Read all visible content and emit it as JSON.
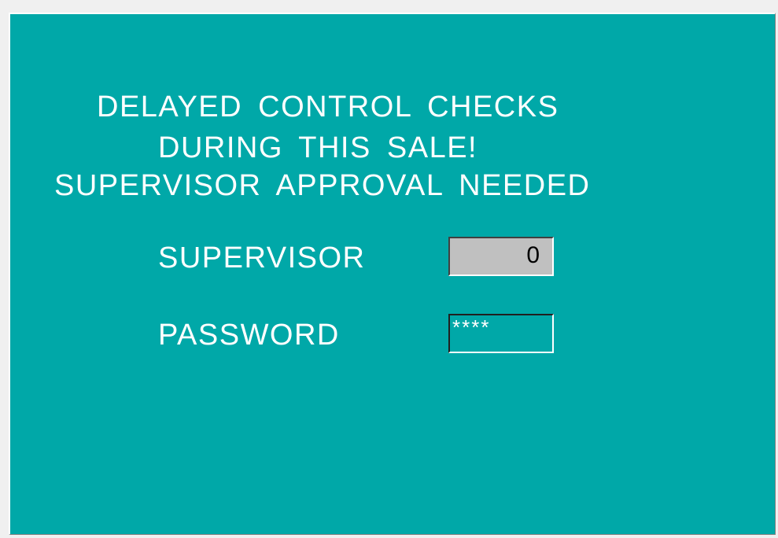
{
  "message": {
    "line1": "DELAYED CONTROL CHECKS",
    "line2": "DURING THIS SALE!",
    "line3": "SUPERVISOR APPROVAL NEEDED"
  },
  "form": {
    "supervisor_label": "SUPERVISOR",
    "supervisor_value": "0",
    "password_label": "PASSWORD",
    "password_value": "****"
  },
  "colors": {
    "panel_background": "#00a8a8",
    "text": "#ffffff",
    "supervisor_field_background": "#c0c0c0"
  }
}
